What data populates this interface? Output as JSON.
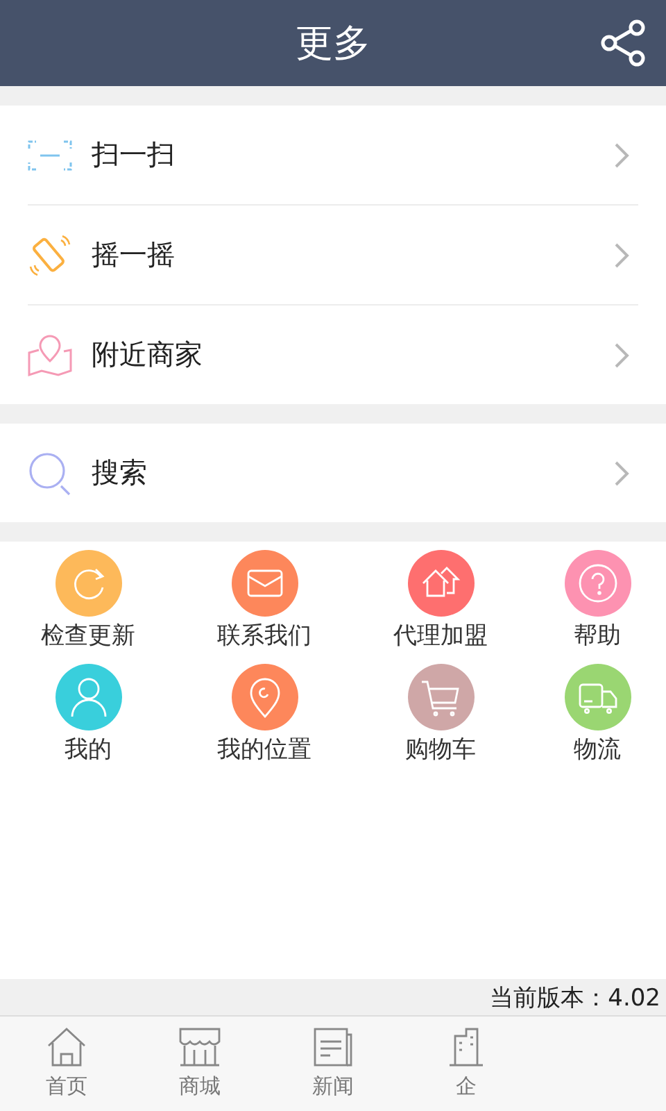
{
  "header": {
    "title": "更多"
  },
  "menu_groups": [
    {
      "items": [
        {
          "kind": "scan",
          "label": "扫一扫"
        },
        {
          "kind": "shake",
          "label": "摇一摇"
        },
        {
          "kind": "map",
          "label": "附近商家"
        }
      ]
    },
    {
      "items": [
        {
          "kind": "search",
          "label": "搜索"
        }
      ]
    }
  ],
  "shortcuts": [
    {
      "kind": "refresh",
      "label": "检查更新",
      "color": "#fdb95a"
    },
    {
      "kind": "mail",
      "label": "联系我们",
      "color": "#fd875b"
    },
    {
      "kind": "house",
      "label": "代理加盟",
      "color": "#fe6f6f"
    },
    {
      "kind": "help",
      "label": "帮助",
      "color": "#fd92b1"
    },
    {
      "kind": "person",
      "label": "我的",
      "color": "#39cfdc"
    },
    {
      "kind": "pin",
      "label": "我的位置",
      "color": "#fd875b"
    },
    {
      "kind": "cart",
      "label": "购物车",
      "color": "#cfa7a7"
    },
    {
      "kind": "truck",
      "label": "物流",
      "color": "#9ad672"
    }
  ],
  "version": "当前版本：4.02",
  "tab_bar": [
    {
      "kind": "home",
      "label": "首页"
    },
    {
      "kind": "shop",
      "label": "商城"
    },
    {
      "kind": "news",
      "label": "新闻"
    },
    {
      "kind": "building",
      "label": "企"
    }
  ]
}
